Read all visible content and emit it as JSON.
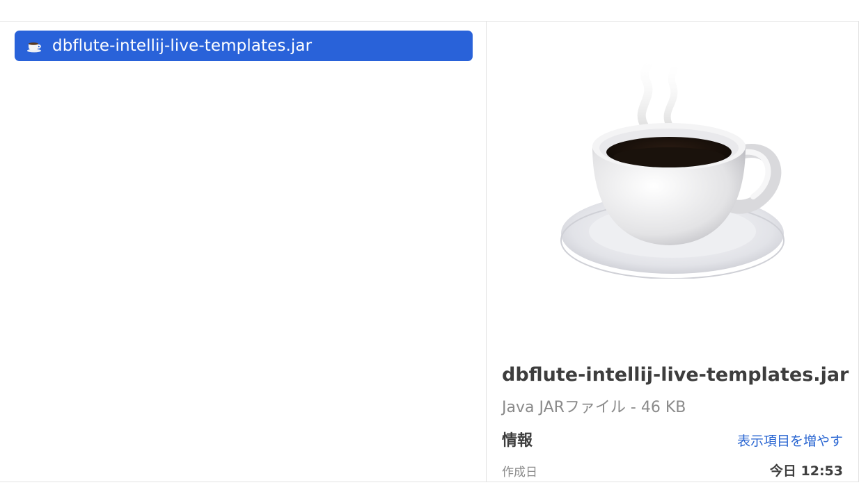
{
  "file_list": {
    "selected_item": {
      "icon": "coffee-cup-icon",
      "label": "dbflute-intellij-live-templates.jar"
    }
  },
  "preview": {
    "icon": "coffee-cup-icon",
    "file_name": "dbflute-intellij-live-templates.jar",
    "kind_and_size": "Java JARファイル - 46 KB",
    "info_heading": "情報",
    "show_more_link": "表示項目を増やす",
    "created_label": "作成日",
    "created_value": "今日 12:53"
  },
  "colors": {
    "selection": "#2962d9",
    "link": "#2b67d2"
  }
}
